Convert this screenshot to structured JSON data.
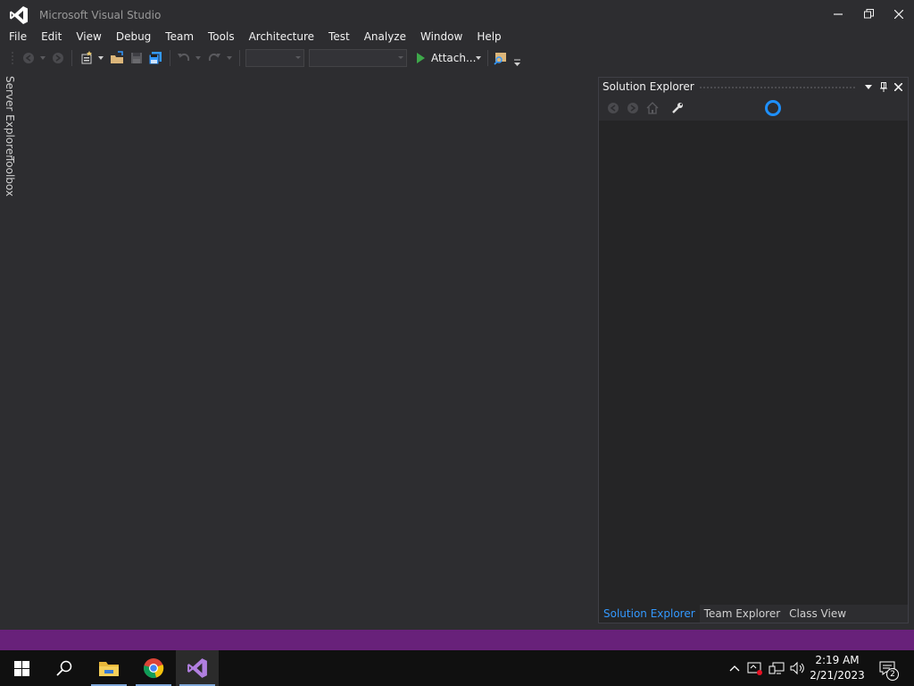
{
  "window": {
    "title": "Microsoft Visual Studio",
    "colors": {
      "background": "#2d2d30",
      "accent": "#68217a",
      "link": "#3399ff"
    }
  },
  "menu": {
    "items": [
      "File",
      "Edit",
      "View",
      "Debug",
      "Team",
      "Tools",
      "Architecture",
      "Test",
      "Analyze",
      "Window",
      "Help"
    ]
  },
  "toolbar": {
    "attach_label": "Attach...",
    "config_value": "",
    "platform_value": "",
    "icons": [
      "back-icon",
      "forward-icon",
      "new-project-icon",
      "open-folder-icon",
      "save-icon",
      "save-all-icon",
      "undo-icon",
      "redo-icon",
      "start-icon",
      "find-in-files-icon"
    ]
  },
  "left_rail": {
    "tabs": [
      "Server Explorer",
      "Toolbox"
    ]
  },
  "solution_explorer": {
    "title": "Solution Explorer",
    "tabs": [
      {
        "label": "Solution Explorer",
        "active": true
      },
      {
        "label": "Team Explorer",
        "active": false
      },
      {
        "label": "Class View",
        "active": false
      }
    ]
  },
  "taskbar": {
    "apps": [
      "windows-start-icon",
      "search-icon",
      "file-explorer-icon",
      "chrome-icon",
      "visual-studio-icon"
    ],
    "clock_time": "2:19 AM",
    "clock_date": "2/21/2023",
    "notification_count": "2"
  }
}
